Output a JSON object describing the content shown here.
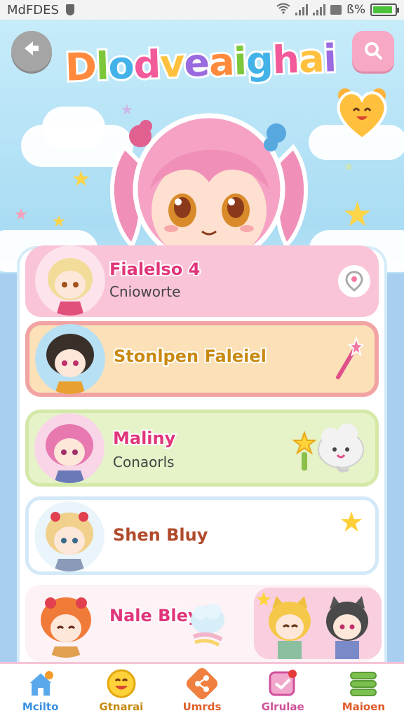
{
  "status_bar": {
    "carrier": "MdFDES",
    "battery_text": "ß%",
    "battery_level": 0.9,
    "colors": {
      "battery": "#4cc23c"
    }
  },
  "header": {
    "title": "Dlodveaighai",
    "back_icon": "back-arrow-icon",
    "search_icon": "search-icon"
  },
  "list": {
    "items": [
      {
        "name": "Fialelso 4",
        "subtitle": "Cnioworte",
        "action_icon": "location-pin-icon"
      },
      {
        "name": "Stonlpen Faleiel",
        "subtitle": "",
        "action_icon": "magic-wand-icon"
      },
      {
        "name": "Maliny",
        "subtitle": "Conaorls",
        "action_icon": "cloud-mascot-icon"
      },
      {
        "name": "Shen Bluy",
        "subtitle": "",
        "action_icon": "star-icon"
      },
      {
        "name": "Nale Bley",
        "subtitle": "",
        "action_icon": "cat-friends-icon"
      }
    ]
  },
  "bottom_nav": {
    "items": [
      {
        "label": "Mcilto",
        "icon": "home-icon",
        "color": "#3a8fe0"
      },
      {
        "label": "Gtnarai",
        "icon": "smiley-icon",
        "color": "#e0a020"
      },
      {
        "label": "Umrds",
        "icon": "share-icon",
        "color": "#e0602a"
      },
      {
        "label": "Glrulae",
        "icon": "message-icon",
        "color": "#d0509a"
      },
      {
        "label": "Maioen",
        "icon": "menu-icon",
        "color": "#e05a2a"
      }
    ]
  },
  "colors": {
    "accent_pink": "#f7a8c4",
    "sky": "#bfe3f5",
    "name_pink": "#e0357a"
  }
}
